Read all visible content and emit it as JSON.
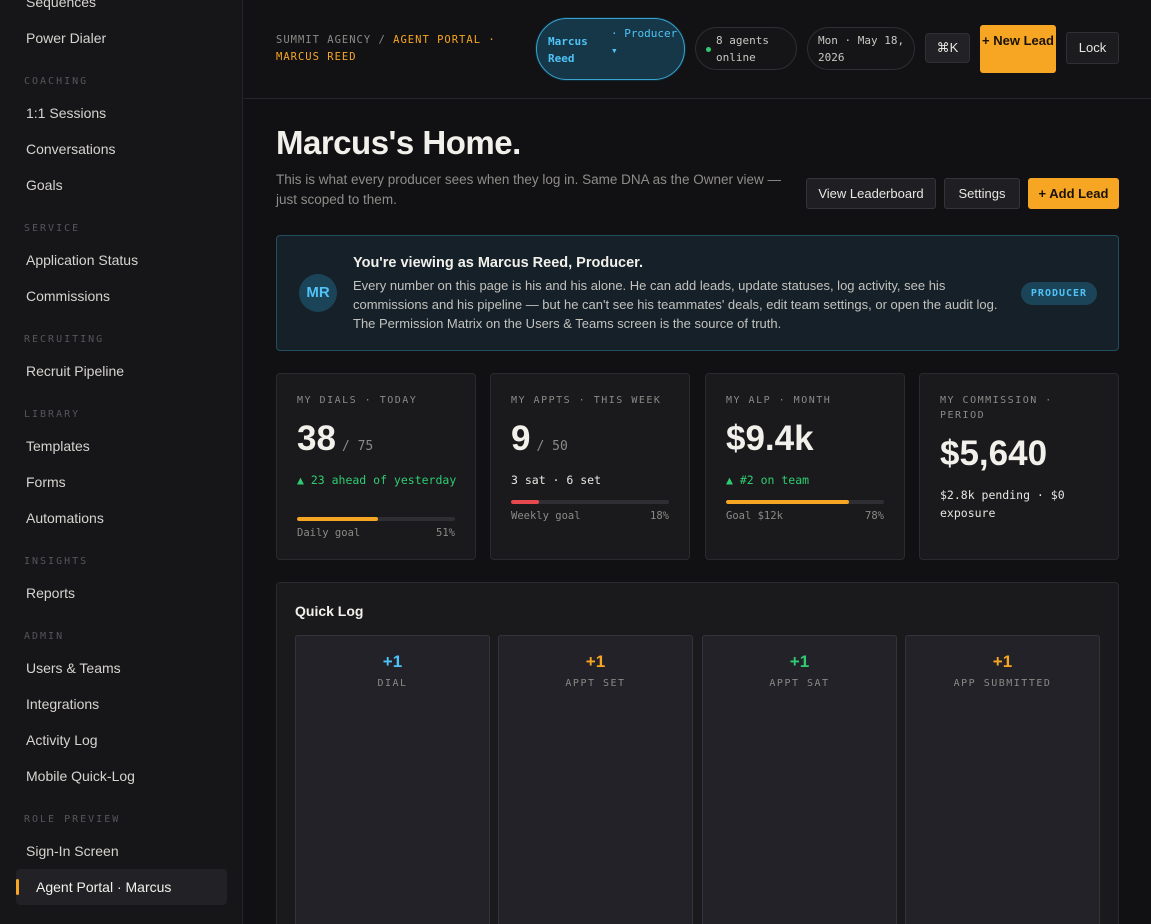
{
  "sidebar": {
    "top_items": [
      "Sequences",
      "Power Dialer"
    ],
    "sections": [
      {
        "title": "COACHING",
        "items": [
          "1:1 Sessions",
          "Conversations",
          "Goals"
        ]
      },
      {
        "title": "SERVICE",
        "items": [
          "Application Status",
          "Commissions"
        ]
      },
      {
        "title": "RECRUITING",
        "items": [
          "Recruit Pipeline"
        ]
      },
      {
        "title": "LIBRARY",
        "items": [
          "Templates",
          "Forms",
          "Automations"
        ]
      },
      {
        "title": "INSIGHTS",
        "items": [
          "Reports"
        ]
      },
      {
        "title": "ADMIN",
        "items": [
          "Users & Teams",
          "Integrations",
          "Activity Log",
          "Mobile Quick-Log"
        ]
      },
      {
        "title": "ROLE PREVIEW",
        "items": [
          "Sign-In Screen",
          "Agent Portal · Marcus"
        ]
      }
    ],
    "active_item": "Agent Portal · Marcus"
  },
  "header": {
    "crumb_prefix": "SUMMIT AGENCY /",
    "crumb_highlight": "AGENT PORTAL · MARCUS REED",
    "role_name": "Marcus Reed",
    "role_label": "· Producer ▾",
    "agents_online": "8 agents online",
    "date": "Mon · May 18, 2026",
    "shortcut": "⌘K",
    "new_lead": "+ New Lead",
    "lock": "Lock"
  },
  "page": {
    "title": "Marcus's Home.",
    "subtitle": "This is what every producer sees when they log in. Same DNA as the Owner view — just scoped to them.",
    "actions": {
      "leaderboard": "View Leaderboard",
      "settings": "Settings",
      "add_lead": "+ Add Lead"
    }
  },
  "banner": {
    "avatar": "MR",
    "title": "You're viewing as Marcus Reed, Producer.",
    "body": "Every number on this page is his and his alone. He can add leads, update statuses, log activity, see his commissions and his pipeline — but he can't see his teammates' deals, edit team settings, or open the audit log. The Permission Matrix on the Users & Teams screen is the source of truth.",
    "badge": "PRODUCER"
  },
  "kpis": [
    {
      "label": "MY DIALS · TODAY",
      "value": "38",
      "of": "/ 75",
      "note": "▲ 23 ahead of yesterday",
      "goal_label": "Daily goal",
      "progress_text": "51%",
      "progress": 0.51,
      "bar_color": "#f6a623",
      "note_color": "#2ecc71"
    },
    {
      "label": "MY APPTS · THIS WEEK",
      "value": "9",
      "of": "/ 50",
      "note": "3 sat · 6 set",
      "goal_label": "Weekly goal",
      "progress_text": "18%",
      "progress": 0.18,
      "bar_color": "#e5484d",
      "note_color": "#e8e6e1"
    },
    {
      "label": "MY ALP · MONTH",
      "value": "$9.4k",
      "of": "",
      "note": "▲ #2 on team",
      "goal_label": "Goal $12k",
      "progress_text": "78%",
      "progress": 0.78,
      "bar_color": "#f6a623",
      "note_color": "#2ecc71"
    },
    {
      "label": "MY COMMISSION · PERIOD",
      "value": "$5,640",
      "of": "",
      "note": "$2.8k pending · $0 exposure",
      "note_color": "#e8e6e1"
    }
  ],
  "quick_log": {
    "title": "Quick Log",
    "cards": [
      {
        "plus": "+1",
        "label": "DIAL",
        "color": "#4fc3f7"
      },
      {
        "plus": "+1",
        "label": "APPT SET",
        "color": "#f6a623"
      },
      {
        "plus": "+1",
        "label": "APPT SAT",
        "color": "#2ecc71"
      },
      {
        "plus": "+1",
        "label": "APP SUBMITTED",
        "color": "#f6a623"
      }
    ]
  }
}
